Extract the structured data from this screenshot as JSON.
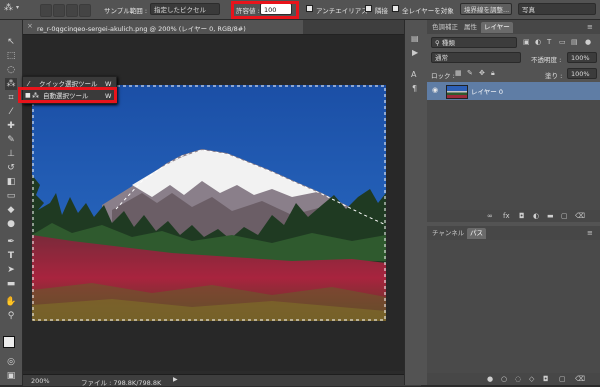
{
  "options_bar": {
    "sample_label": "サンプル範囲 :",
    "sample_value": "指定したピクセル",
    "tolerance_label": "許容値 :",
    "tolerance_value": "100",
    "antialias_label": "アンチエイリアス",
    "contiguous_label": "隣接",
    "all_layers_label": "全レイヤーを対象",
    "refine_edge_button": "境界線を調整...",
    "workspace_value": "写真"
  },
  "document": {
    "tab_title": "re_r-0qgcinqeo-sergei-akulich.png @ 200% (レイヤー 0, RGB/8#)",
    "status_zoom": "200%",
    "status_file": "ファイル : 798.8K/798.8K"
  },
  "tool_flyout": {
    "items": [
      {
        "label": "クイック選択ツール",
        "shortcut": "W"
      },
      {
        "label": "自動選択ツール",
        "shortcut": "W"
      }
    ]
  },
  "layers_panel": {
    "tabs": [
      "色調補正",
      "属性",
      "レイヤー"
    ],
    "filter_value": "種類",
    "blend_mode": "通常",
    "opacity_label": "不透明度 :",
    "opacity_value": "100%",
    "lock_label": "ロック :",
    "fill_label": "塗り :",
    "fill_value": "100%",
    "layer_name": "レイヤー 0"
  },
  "channels_panel": {
    "tabs": [
      "チャンネル",
      "パス"
    ]
  },
  "colors": {
    "highlight": "#e8141b",
    "layer_selected": "#5f7da5"
  }
}
